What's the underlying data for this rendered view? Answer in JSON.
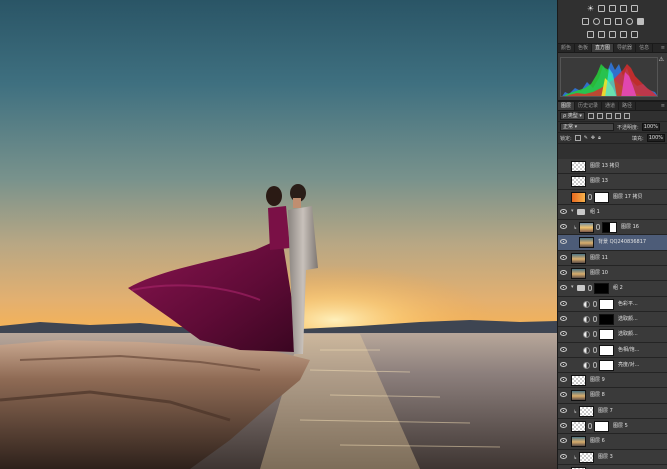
{
  "panel": {
    "tabs": [
      {
        "label": "颜色",
        "active": false
      },
      {
        "label": "色板",
        "active": false
      },
      {
        "label": "直方图",
        "active": true
      },
      {
        "label": "导航器",
        "active": false
      },
      {
        "label": "信息",
        "active": false
      }
    ],
    "layer_tabs": [
      {
        "label": "图层",
        "active": true
      },
      {
        "label": "历史记录",
        "active": false
      },
      {
        "label": "通道",
        "active": false
      },
      {
        "label": "路径",
        "active": false
      }
    ],
    "filter_kind": "类型",
    "blend_mode": "正常",
    "opacity_label": "不透明度:",
    "opacity_value": "100%",
    "lock_label": "锁定:",
    "fill_label": "填充:",
    "fill_value": "100%",
    "warning_icon": "warning-icon"
  },
  "layers": [
    {
      "name": "图层 13 拷贝",
      "visible": false,
      "thumb": "checker",
      "indent": 0
    },
    {
      "name": "图层 13",
      "visible": false,
      "thumb": "checker",
      "indent": 0
    },
    {
      "name": "图层 17 拷贝",
      "visible": false,
      "thumb": "orange",
      "mask": true,
      "indent": 0
    },
    {
      "name": "组 1",
      "visible": true,
      "group": true,
      "expanded": true,
      "indent": 0
    },
    {
      "name": "图层 16",
      "visible": true,
      "thumb": "photo2",
      "mask": "blackwhite",
      "clip": true,
      "indent": 1
    },
    {
      "name": "背景 QQ240836817",
      "visible": true,
      "thumb": "photo",
      "selected": true,
      "indent": 1
    },
    {
      "name": "图层 11",
      "visible": true,
      "thumb": "photo",
      "indent": 0
    },
    {
      "name": "图层 10",
      "visible": true,
      "thumb": "photo",
      "indent": 0
    },
    {
      "name": "组 2",
      "visible": true,
      "group": true,
      "expanded": true,
      "mask": "black",
      "indent": 0
    },
    {
      "name": "色彩平...",
      "visible": true,
      "adjust": true,
      "indent": 1
    },
    {
      "name": "选取颜...",
      "visible": true,
      "adjust": true,
      "mask": "black",
      "indent": 1
    },
    {
      "name": "选取颜...",
      "visible": true,
      "adjust": true,
      "indent": 1
    },
    {
      "name": "色相/饱...",
      "visible": true,
      "adjust": true,
      "indent": 1
    },
    {
      "name": "亮度/对...",
      "visible": true,
      "adjust": true,
      "indent": 1
    },
    {
      "name": "图层 9",
      "visible": true,
      "thumb": "checker",
      "indent": 0
    },
    {
      "name": "图层 8",
      "visible": true,
      "thumb": "photo",
      "indent": 0
    },
    {
      "name": "图层 7",
      "visible": true,
      "thumb": "checker",
      "clip": true,
      "indent": 1
    },
    {
      "name": "图层 5",
      "visible": true,
      "thumb": "checker",
      "mask": true,
      "indent": 0
    },
    {
      "name": "图层 6",
      "visible": true,
      "thumb": "photo",
      "indent": 0
    },
    {
      "name": "图层 3",
      "visible": true,
      "thumb": "checker",
      "clip": true,
      "indent": 1
    },
    {
      "name": "图层 4",
      "visible": true,
      "thumb": "checker",
      "indent": 0
    }
  ]
}
